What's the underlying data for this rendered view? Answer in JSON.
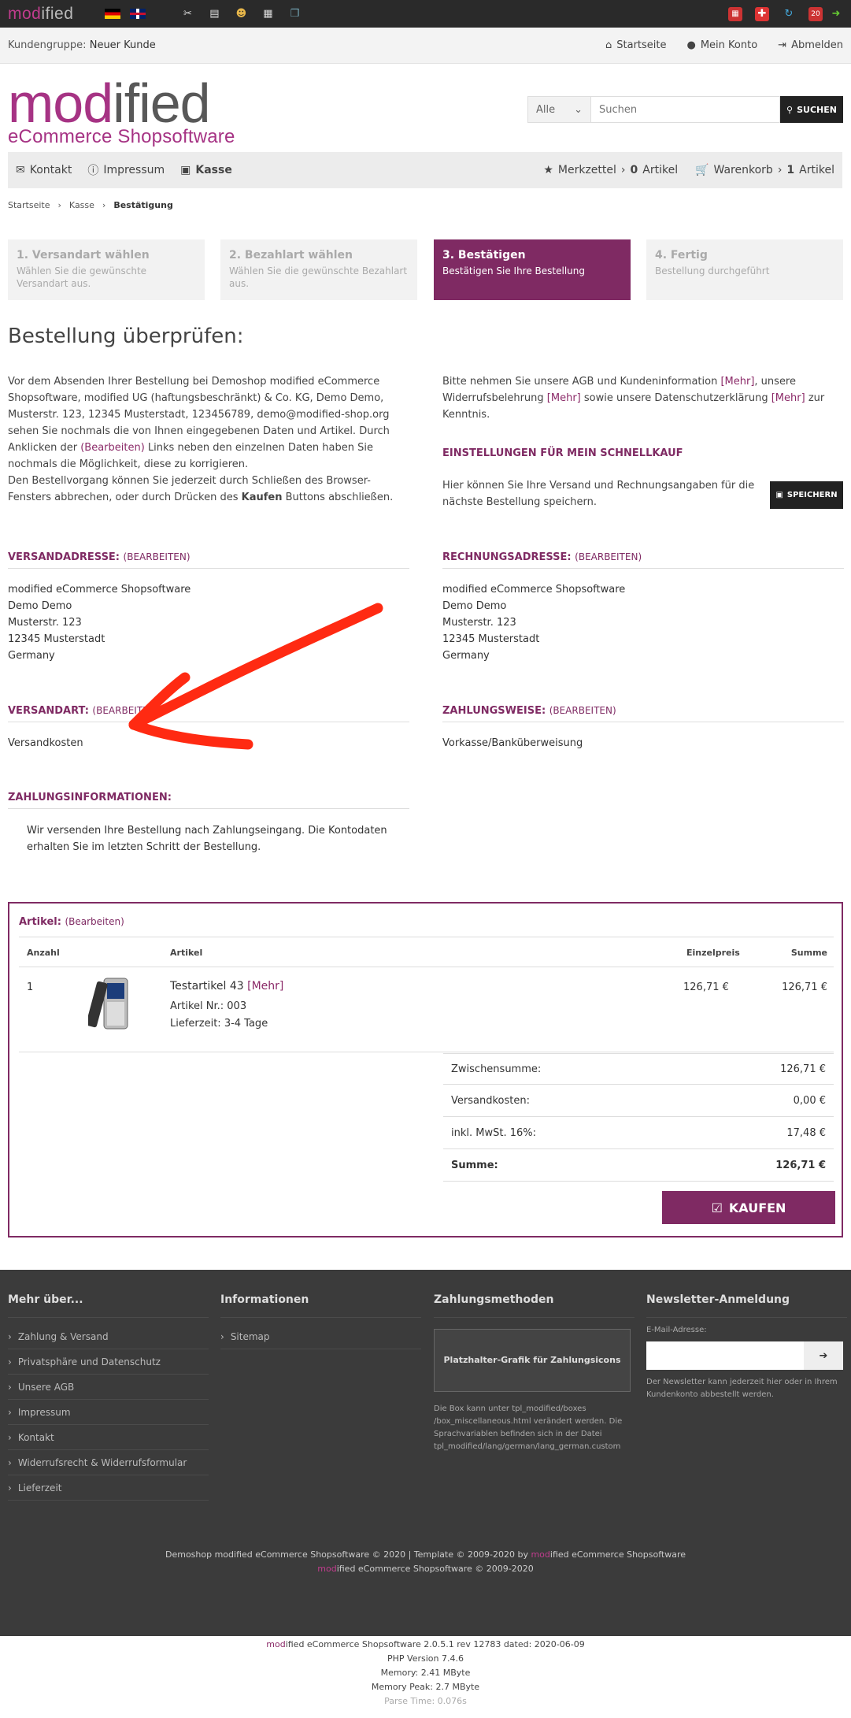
{
  "adminbar": {
    "logo_pre": "mod",
    "logo_post": "ified"
  },
  "custbar": {
    "group_label": "Kundengruppe:",
    "group_value": "Neuer Kunde",
    "home": "Startseite",
    "account": "Mein Konto",
    "logout": "Abmelden"
  },
  "brand": {
    "word_a": "mod",
    "word_b": "ified",
    "tagline": "eCommerce Shopsoftware"
  },
  "search": {
    "category": "Alle",
    "placeholder": "Suchen",
    "button": "SUCHEN"
  },
  "nav": {
    "contact": "Kontakt",
    "imprint": "Impressum",
    "checkout": "Kasse",
    "wishlist": "Merkzettel",
    "wishlist_count": "0",
    "wishlist_unit": "Artikel",
    "cart": "Warenkorb",
    "cart_count": "1",
    "cart_unit": "Artikel"
  },
  "breadcrumb": [
    "Startseite",
    "Kasse",
    "Bestätigung"
  ],
  "steps": [
    {
      "title": "1. Versandart wählen",
      "desc": "Wählen Sie die gewünschte Versandart aus."
    },
    {
      "title": "2. Bezahlart wählen",
      "desc": "Wählen Sie die gewünschte Bezahlart aus."
    },
    {
      "title": "3. Bestätigen",
      "desc": "Bestätigen Sie Ihre Bestellung"
    },
    {
      "title": "4. Fertig",
      "desc": "Bestellung durchgeführt"
    }
  ],
  "heading": "Bestellung überprüfen:",
  "intro": {
    "p1": "Vor dem Absenden Ihrer Bestellung bei Demoshop modified eCommerce Shopsoftware, modified UG (haftungsbeschränkt) & Co. KG, Demo Demo, Musterstr. 123, 12345 Musterstadt, 123456789, demo@modified-shop.org sehen Sie nochmals die von Ihnen eingegebenen Daten und Artikel. Durch Anklicken der",
    "edit_word": "(Bearbeiten)",
    "p2": "Links neben den einzelnen Daten haben Sie nochmals die Möglichkeit, diese zu korrigieren.",
    "p3": "Den Bestellvorgang können Sie jederzeit durch Schließen des Browser-Fensters abbrechen, oder durch Drücken des",
    "kaufen_word": "Kaufen",
    "p4": "Buttons abschließen."
  },
  "agb": {
    "a": "Bitte nehmen Sie unsere AGB und Kundeninformation",
    "more": "[Mehr]",
    "b": ", unsere Widerrufsbelehrung",
    "c": "sowie unsere Datenschutzerklärung",
    "d": "zur Kenntnis."
  },
  "quick": {
    "title": "Einstellungen für mein Schnellkauf",
    "text": "Hier können Sie Ihre Versand und Rechnungsangaben für die nächste Bestellung speichern.",
    "button": "SPEICHERN"
  },
  "shipping_address": {
    "title": "Versandadresse:",
    "edit": "(Bearbeiten)",
    "lines": [
      "modified eCommerce Shopsoftware",
      "Demo Demo",
      "Musterstr. 123",
      "12345 Musterstadt",
      "Germany"
    ]
  },
  "billing_address": {
    "title": "Rechnungsadresse:",
    "edit": "(Bearbeiten)",
    "lines": [
      "modified eCommerce Shopsoftware",
      "Demo Demo",
      "Musterstr. 123",
      "12345 Musterstadt",
      "Germany"
    ]
  },
  "shipping_method": {
    "title": "Versandart:",
    "edit": "(Bearbeiten)",
    "value": "Versandkosten"
  },
  "payment_method": {
    "title": "Zahlungsweise:",
    "edit": "(Bearbeiten)",
    "value": "Vorkasse/Banküberweisung"
  },
  "payment_info": {
    "title": "Zahlungsinformationen:",
    "text": "Wir versenden Ihre Bestellung nach Zahlungseingang. Die Kontodaten erhalten Sie im letzten Schritt der Bestellung."
  },
  "products": {
    "title": "Artikel:",
    "edit": "(Bearbeiten)",
    "headers": {
      "qty": "Anzahl",
      "article": "Artikel",
      "unit_price": "Einzelpreis",
      "sum": "Summe"
    },
    "item": {
      "qty": "1",
      "name": "Testartikel 43",
      "more": "[Mehr]",
      "nr": "Artikel Nr.: 003",
      "delivery": "Lieferzeit: 3-4 Tage",
      "unit_price": "126,71 €",
      "sum": "126,71 €"
    },
    "totals": [
      {
        "label": "Zwischensumme:",
        "value": "126,71 €"
      },
      {
        "label": "Versandkosten:",
        "value": "0,00 €"
      },
      {
        "label": "inkl. MwSt. 16%:",
        "value": "17,48 €"
      },
      {
        "label": "Summe:",
        "value": "126,71 €"
      }
    ],
    "buy": "KAUFEN"
  },
  "footer": {
    "col1": {
      "title": "Mehr über...",
      "items": [
        "Zahlung & Versand",
        "Privatsphäre und Datenschutz",
        "Unsere AGB",
        "Impressum",
        "Kontakt",
        "Widerrufsrecht & Widerrufsformular",
        "Lieferzeit"
      ]
    },
    "col2": {
      "title": "Informationen",
      "items": [
        "Sitemap"
      ]
    },
    "col3": {
      "title": "Zahlungsmethoden",
      "placeholder": "Platzhalter-Grafik für Zahlungsicons",
      "note": "Die Box kann unter tpl_modified/boxes /box_miscellaneous.html verändert werden. Die Sprachvariablen befinden sich in der Datei tpl_modified/lang/german/lang_german.custom"
    },
    "col4": {
      "title": "Newsletter-Anmeldung",
      "label": "E-Mail-Adresse:",
      "note": "Der Newsletter kann jederzeit hier oder in Ihrem Kundenkonto abbestellt werden."
    },
    "copy1a": "Demoshop modified eCommerce Shopsoftware © 2020 | Template © 2009-2020 by ",
    "copy_mod": "mod",
    "copy1b": "ified eCommerce Shopsoftware",
    "copy2a": "mod",
    "copy2b": "ified eCommerce Shopsoftware © 2009-2020"
  },
  "bottom": {
    "l1a": "mod",
    "l1b": "ified eCommerce Shopsoftware 2.0.5.1 rev 12783 dated: 2020-06-09",
    "l2": "PHP Version 7.4.6",
    "l3": "Memory: 2.41 MByte",
    "l4": "Memory Peak: 2.7 MByte",
    "l5": "Parse Time: 0.076s"
  },
  "colors": {
    "accent": "#7f2a63",
    "brand": "#a63384",
    "arrow": "#ff2a12",
    "dark": "#222222",
    "footer": "#3b3b3b"
  }
}
